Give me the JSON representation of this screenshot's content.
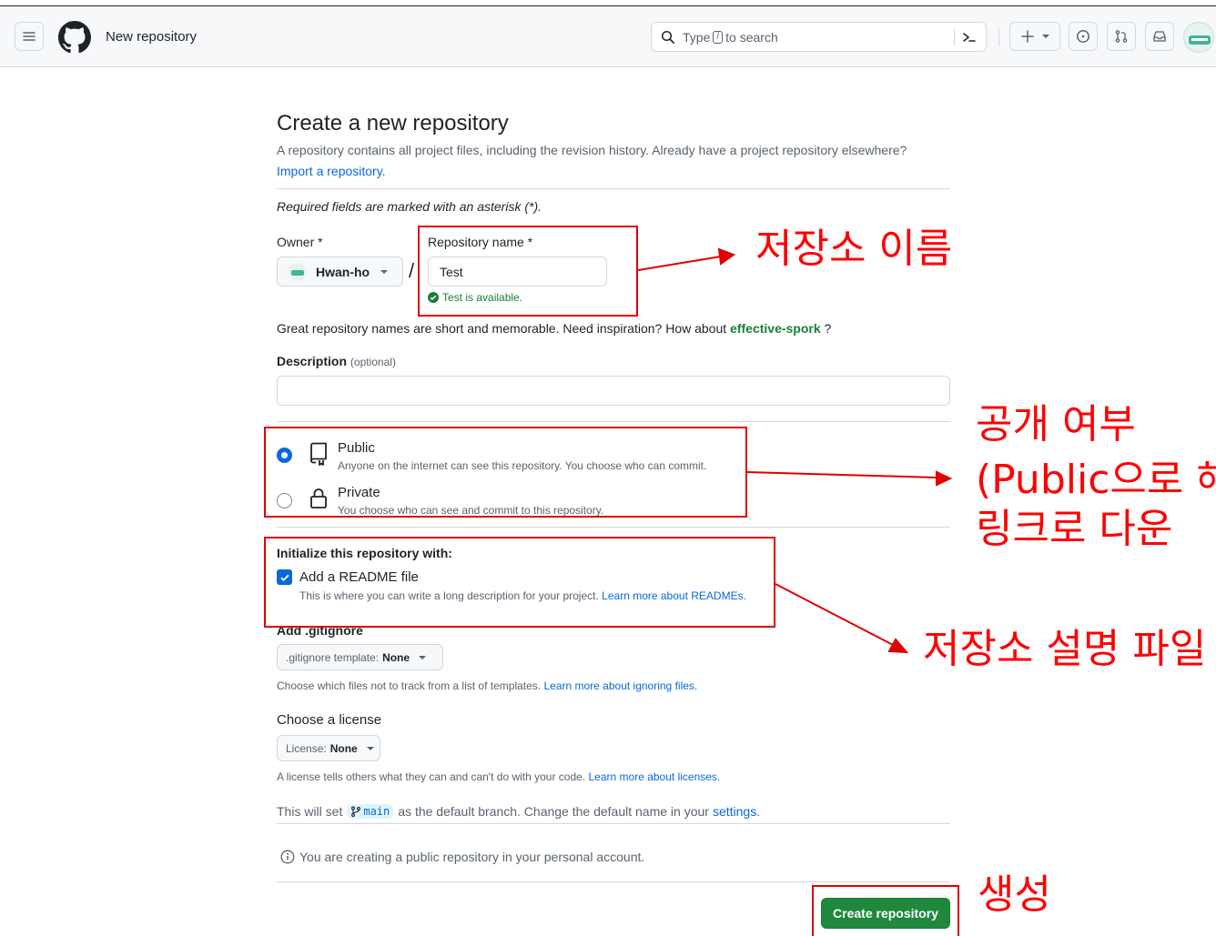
{
  "header": {
    "page_title": "New repository",
    "search": {
      "prefix": "Type",
      "key": "/",
      "suffix": "to search"
    }
  },
  "main": {
    "title": "Create a new repository",
    "intro": "A repository contains all project files, including the revision history. Already have a project repository elsewhere?",
    "import_link": "Import a repository.",
    "required_note": "Required fields are marked with an asterisk (*).",
    "owner": {
      "label": "Owner *",
      "value": "Hwan-ho"
    },
    "separator": "/",
    "repo_name": {
      "label": "Repository name *",
      "value": "Test",
      "status": "Test is available."
    },
    "name_hint_prefix": "Great repository names are short and memorable. Need inspiration? How about",
    "name_suggestion": "effective-spork",
    "name_hint_suffix": "?",
    "description": {
      "label": "Description",
      "optional": "(optional)",
      "value": ""
    },
    "visibility": {
      "public": {
        "label": "Public",
        "desc": "Anyone on the internet can see this repository. You choose who can commit.",
        "selected": true
      },
      "private": {
        "label": "Private",
        "desc": "You choose who can see and commit to this repository.",
        "selected": false
      }
    },
    "initialize": {
      "heading": "Initialize this repository with:",
      "readme": {
        "label": "Add a README file",
        "checked": true,
        "desc": "This is where you can write a long description for your project.",
        "link": "Learn more about READMEs."
      }
    },
    "gitignore": {
      "heading": "Add .gitignore",
      "button_prefix": ".gitignore template:",
      "button_value": "None",
      "help": "Choose which files not to track from a list of templates.",
      "help_link": "Learn more about ignoring files."
    },
    "license": {
      "heading": "Choose a license",
      "button_prefix": "License:",
      "button_value": "None",
      "help": "A license tells others what they can and can't do with your code.",
      "help_link": "Learn more about licenses."
    },
    "branch": {
      "prefix": "This will set",
      "name": "main",
      "middle": "as the default branch. Change the default name in your",
      "link": "settings",
      "suffix": "."
    },
    "info_note": "You are creating a public repository in your personal account.",
    "create_button": "Create repository"
  },
  "annotations": {
    "repo_name": "저장소 이름",
    "visibility_line1": "공개 여부",
    "visibility_line2": "(Public으로 해",
    "visibility_line3": "링크로 다운",
    "readme": "저장소 설명 파일",
    "create": "생성"
  },
  "colors": {
    "annotation_red": "#ff0000",
    "accent_blue": "#0969da",
    "success_green": "#1a7f37",
    "button_green": "#1f883d"
  }
}
